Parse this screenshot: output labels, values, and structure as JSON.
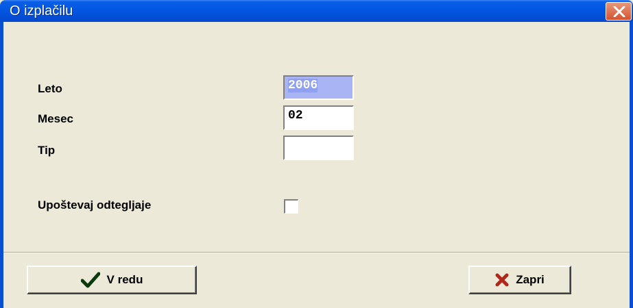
{
  "window": {
    "title": "O izplačilu"
  },
  "form": {
    "year_label": "Leto",
    "year_value": "2006",
    "month_label": "Mesec",
    "month_value": "02",
    "type_label": "Tip",
    "type_value": "",
    "deductions_label": "Upoštevaj odtegljaje",
    "deductions_checked": false
  },
  "buttons": {
    "ok_label": "V redu",
    "cancel_label": "Zapri"
  },
  "icons": {
    "ok": "checkmark-icon",
    "cancel": "x-icon",
    "close": "close-icon"
  }
}
